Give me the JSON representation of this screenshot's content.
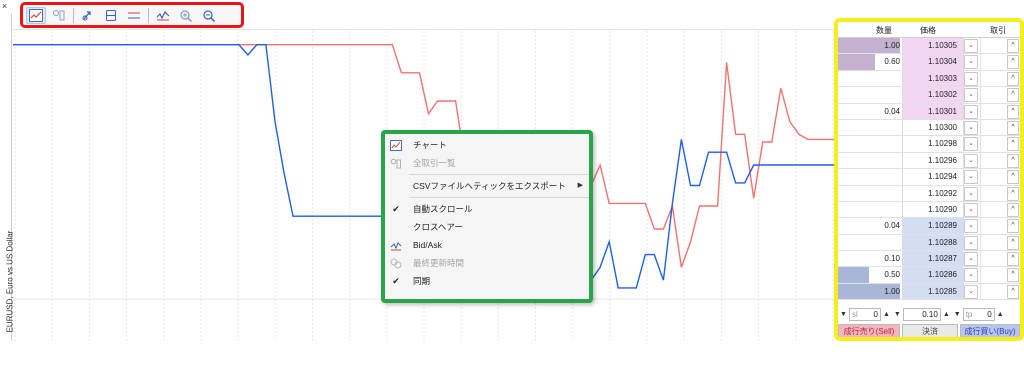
{
  "window": {
    "close_label": "×",
    "symbol_label": "EURUSD, Euro vs US Dollar"
  },
  "toolbar": {
    "icons": [
      "chart-icon",
      "all-trades-icon",
      "auto-scroll-icon",
      "crosshair-icon",
      "bid-ask-icon",
      "last-update-icon",
      "zoom-in-icon",
      "zoom-out-icon"
    ]
  },
  "chart_data": {
    "type": "line",
    "x_ticks": 23,
    "series": [
      {
        "color": "#f27272",
        "values": [
          0.97,
          0.97,
          0.97,
          0.97,
          0.97,
          0.97,
          0.97,
          0.97,
          0.97,
          0.97,
          0.97,
          0.97,
          0.97,
          0.97,
          0.97,
          0.97,
          0.97,
          0.97,
          0.97,
          0.97,
          0.97,
          0.97,
          0.97,
          0.97,
          0.97,
          0.97,
          0.97,
          0.97,
          0.97,
          0.97,
          0.97,
          0.97,
          0.97,
          0.97,
          0.97,
          0.97,
          0.97,
          0.97,
          0.97,
          0.97,
          0.97,
          0.97,
          0.97,
          0.86,
          0.86,
          0.86,
          0.7,
          0.75,
          0.75,
          0.75,
          0.52,
          0.58,
          0.58,
          0.58,
          0.42,
          0.42,
          0.42,
          0.42,
          0.42,
          0.42,
          0.42,
          0.42,
          0.42,
          0.42,
          0.42,
          0.5,
          0.35,
          0.35,
          0.35,
          0.35,
          0.35,
          0.25,
          0.25,
          0.34,
          0.1,
          0.2,
          0.34,
          0.34,
          0.34,
          0.9,
          0.62,
          0.62,
          0.37,
          0.59,
          0.59,
          0.8,
          0.67,
          0.62,
          0.6,
          0.6,
          0.6,
          0.6
        ]
      },
      {
        "color": "#1f5fe8",
        "values": [
          0.97,
          0.97,
          0.97,
          0.97,
          0.97,
          0.97,
          0.97,
          0.97,
          0.97,
          0.97,
          0.97,
          0.97,
          0.97,
          0.97,
          0.97,
          0.97,
          0.97,
          0.97,
          0.97,
          0.97,
          0.97,
          0.97,
          0.97,
          0.97,
          0.97,
          0.97,
          0.93,
          0.97,
          0.97,
          0.67,
          0.47,
          0.3,
          0.3,
          0.3,
          0.3,
          0.3,
          0.3,
          0.3,
          0.3,
          0.3,
          0.3,
          0.3,
          0.3,
          0.3,
          0.3,
          0.3,
          0.3,
          0.3,
          0.3,
          0.3,
          0.3,
          0.3,
          0.3,
          0.3,
          0.3,
          0.3,
          0.3,
          0.3,
          0.3,
          0.3,
          0.3,
          0.3,
          0.1,
          0.05,
          0.05,
          0.1,
          0.2,
          0.02,
          0.02,
          0.02,
          0.15,
          0.15,
          0.05,
          0.35,
          0.6,
          0.42,
          0.42,
          0.55,
          0.55,
          0.55,
          0.43,
          0.43,
          0.5,
          0.5,
          0.5,
          0.5,
          0.5,
          0.5,
          0.5,
          0.5,
          0.5,
          0.5
        ]
      }
    ]
  },
  "context_menu": {
    "items": [
      {
        "label": "チャート",
        "icon": "chart-icon",
        "checked": false,
        "disabled": false
      },
      {
        "label": "全取引一覧",
        "icon": "all-trades-icon",
        "checked": false,
        "disabled": true
      },
      {
        "label": "CSVファイルへティックをエクスポート",
        "icon": "",
        "checked": false,
        "disabled": false,
        "submenu": true
      },
      {
        "label": "自動スクロール",
        "icon": "",
        "checked": true,
        "disabled": false
      },
      {
        "label": "クロスヘアー",
        "icon": "",
        "checked": false,
        "disabled": false
      },
      {
        "label": "Bid/Ask",
        "icon": "bid-ask-icon",
        "checked": false,
        "disabled": false
      },
      {
        "label": "最終更新時間",
        "icon": "last-update-icon",
        "checked": false,
        "disabled": true
      },
      {
        "label": "同期",
        "icon": "",
        "checked": true,
        "disabled": false
      }
    ],
    "check_mark": "✔",
    "submenu_arrow": "▶"
  },
  "dom": {
    "headers": {
      "qty": "数量",
      "price": "価格",
      "trade": "取引"
    },
    "rows": [
      {
        "qty": "1.00",
        "price": "1.10305",
        "side": "ask",
        "depth": 1.0
      },
      {
        "qty": "0.60",
        "price": "1.10304",
        "side": "ask",
        "depth": 0.6
      },
      {
        "qty": "",
        "price": "1.10303",
        "side": "ask",
        "depth": 0
      },
      {
        "qty": "",
        "price": "1.10302",
        "side": "ask",
        "depth": 0
      },
      {
        "qty": "0.04",
        "price": "1.10301",
        "side": "ask",
        "depth": 0
      },
      {
        "qty": "",
        "price": "1.10300",
        "side": "none",
        "depth": 0
      },
      {
        "qty": "",
        "price": "1.10298",
        "side": "none",
        "depth": 0
      },
      {
        "qty": "",
        "price": "1.10296",
        "side": "none",
        "depth": 0
      },
      {
        "qty": "",
        "price": "1.10294",
        "side": "none",
        "depth": 0
      },
      {
        "qty": "",
        "price": "1.10292",
        "side": "none",
        "depth": 0
      },
      {
        "qty": "",
        "price": "1.10290",
        "side": "none",
        "depth": 0
      },
      {
        "qty": "0.04",
        "price": "1.10289",
        "side": "bid",
        "depth": 0
      },
      {
        "qty": "",
        "price": "1.10288",
        "side": "bid",
        "depth": 0
      },
      {
        "qty": "0.10",
        "price": "1.10287",
        "side": "bid",
        "depth": 0
      },
      {
        "qty": "0.50",
        "price": "1.10286",
        "side": "bid",
        "depth": 0.5
      },
      {
        "qty": "1.00",
        "price": "1.10285",
        "side": "bid",
        "depth": 1.0
      }
    ],
    "dropdown_glyph": "⌄",
    "up_glyph": "^",
    "sl_placeholder": "sl",
    "sl_value": "0",
    "volume_value": "0.10",
    "tp_placeholder": "tp",
    "tp_value": "0",
    "spin_down": "▼",
    "spin_up": "▲",
    "sell_label": "成行売り(Sell)",
    "close_label": "決済",
    "buy_label": "成行買い(Buy)",
    "colors": {
      "ask_bg": "#f3d6f2",
      "ask_bar": "#c4b0d0",
      "bid_bg": "#d3def5",
      "bid_bar": "#a9b6d8"
    }
  }
}
